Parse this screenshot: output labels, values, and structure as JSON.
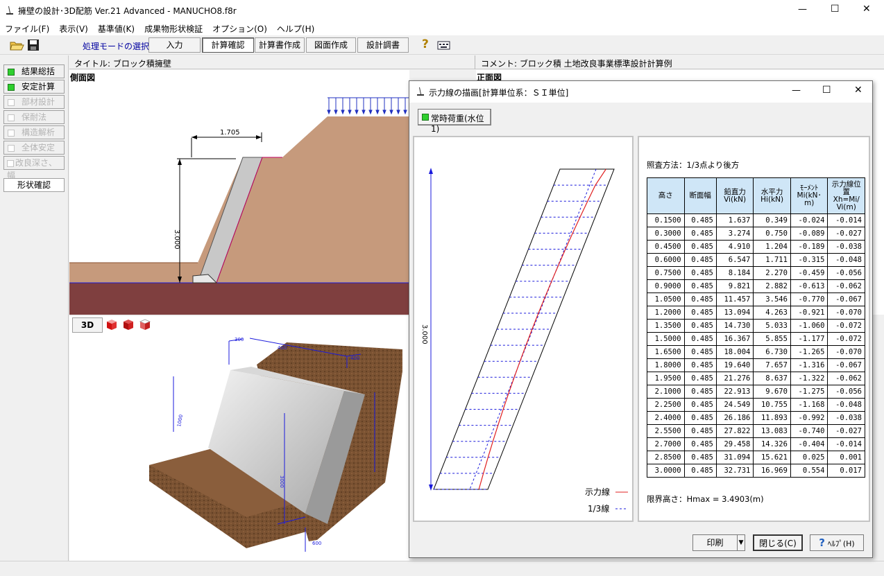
{
  "window": {
    "title": "擁壁の設計･3D配筋 Ver.21 Advanced  - MANUCHO8.f8r",
    "controls": {
      "minimize": "—",
      "maximize": "☐",
      "close": "✕"
    }
  },
  "menu": [
    "ファイル(F)",
    "表示(V)",
    "基準値(K)",
    "成果物形状検証",
    "オプション(O)",
    "ヘルプ(H)"
  ],
  "toolbar": {
    "mode_label": "処理モードの選択",
    "tabs": [
      "入力",
      "計算確認",
      "計算書作成",
      "図面作成",
      "設計調書"
    ],
    "active_tab": "計算確認",
    "help_glyph": "?"
  },
  "left_panel": {
    "items": [
      {
        "label": "結果総括",
        "enabled": true
      },
      {
        "label": "安定計算",
        "enabled": true
      },
      {
        "label": "部材設計",
        "enabled": false
      },
      {
        "label": "保耐法",
        "enabled": false
      },
      {
        "label": "構造解析",
        "enabled": false
      },
      {
        "label": "全体安定",
        "enabled": false
      },
      {
        "label": "改良深さ、幅",
        "enabled": false
      }
    ],
    "shape_check": "形状確認"
  },
  "title_strip": {
    "title": "タイトル: ブロック積擁壁",
    "comment": "コメント: ブロック積 土地改良事業標準設計計算例"
  },
  "side_view": {
    "label": "側面図",
    "dim_width": "1.705",
    "dim_height": "3.000"
  },
  "front_view": {
    "label": "正面図"
  },
  "view3d": {
    "btn_3d": "3D",
    "dims": {
      "top_a": "300",
      "top_b": "400",
      "top_c": "400",
      "height_a": "1000",
      "height_b": "3000",
      "bottom": "600"
    }
  },
  "dialog": {
    "title": "示力線の描画[計算単位系：ＳＩ単位]",
    "case_button": "常時荷重(水位1)",
    "plot": {
      "height_dim": "3.000",
      "legend": [
        {
          "label": "示力線",
          "color": "#e02020",
          "style": "solid"
        },
        {
          "label": "1/3線",
          "color": "#1a1adc",
          "style": "dashed"
        }
      ]
    },
    "method_text": "照査方法：1/3点より後方",
    "table": {
      "headers": [
        "高さ",
        "断面幅",
        "鉛直力\nVi(kN)",
        "水平力\nHi(kN)",
        "ﾓｰﾒﾝﾄ\nMi(kN･\nm)",
        "示力線位\n置\nXh=Mi/\nVi(m)"
      ],
      "rows": [
        [
          "0.1500",
          "0.485",
          "1.637",
          "0.349",
          "-0.024",
          "-0.014"
        ],
        [
          "0.3000",
          "0.485",
          "3.274",
          "0.750",
          "-0.089",
          "-0.027"
        ],
        [
          "0.4500",
          "0.485",
          "4.910",
          "1.204",
          "-0.189",
          "-0.038"
        ],
        [
          "0.6000",
          "0.485",
          "6.547",
          "1.711",
          "-0.315",
          "-0.048"
        ],
        [
          "0.7500",
          "0.485",
          "8.184",
          "2.270",
          "-0.459",
          "-0.056"
        ],
        [
          "0.9000",
          "0.485",
          "9.821",
          "2.882",
          "-0.613",
          "-0.062"
        ],
        [
          "1.0500",
          "0.485",
          "11.457",
          "3.546",
          "-0.770",
          "-0.067"
        ],
        [
          "1.2000",
          "0.485",
          "13.094",
          "4.263",
          "-0.921",
          "-0.070"
        ],
        [
          "1.3500",
          "0.485",
          "14.730",
          "5.033",
          "-1.060",
          "-0.072"
        ],
        [
          "1.5000",
          "0.485",
          "16.367",
          "5.855",
          "-1.177",
          "-0.072"
        ],
        [
          "1.6500",
          "0.485",
          "18.004",
          "6.730",
          "-1.265",
          "-0.070"
        ],
        [
          "1.8000",
          "0.485",
          "19.640",
          "7.657",
          "-1.316",
          "-0.067"
        ],
        [
          "1.9500",
          "0.485",
          "21.276",
          "8.637",
          "-1.322",
          "-0.062"
        ],
        [
          "2.1000",
          "0.485",
          "22.913",
          "9.670",
          "-1.275",
          "-0.056"
        ],
        [
          "2.2500",
          "0.485",
          "24.549",
          "10.755",
          "-1.168",
          "-0.048"
        ],
        [
          "2.4000",
          "0.485",
          "26.186",
          "11.893",
          "-0.992",
          "-0.038"
        ],
        [
          "2.5500",
          "0.485",
          "27.822",
          "13.083",
          "-0.740",
          "-0.027"
        ],
        [
          "2.7000",
          "0.485",
          "29.458",
          "14.326",
          "-0.404",
          "-0.014"
        ],
        [
          "2.8500",
          "0.485",
          "31.094",
          "15.621",
          "0.025",
          "0.001"
        ],
        [
          "3.0000",
          "0.485",
          "32.731",
          "16.969",
          "0.554",
          "0.017"
        ]
      ]
    },
    "limit_text": "限界高さ：Hmax = 3.4903(m)",
    "buttons": {
      "print": "印刷",
      "dropdown": "▼",
      "close": "閉じる(C)",
      "help": "ﾍﾙﾌﾟ(H)"
    }
  },
  "colors": {
    "soil": "#c69a7c",
    "ground": "#7f3f3f",
    "wall": "#c8c8c8",
    "header_bg": "#cfe6f7",
    "green": "#2fcf2f"
  }
}
